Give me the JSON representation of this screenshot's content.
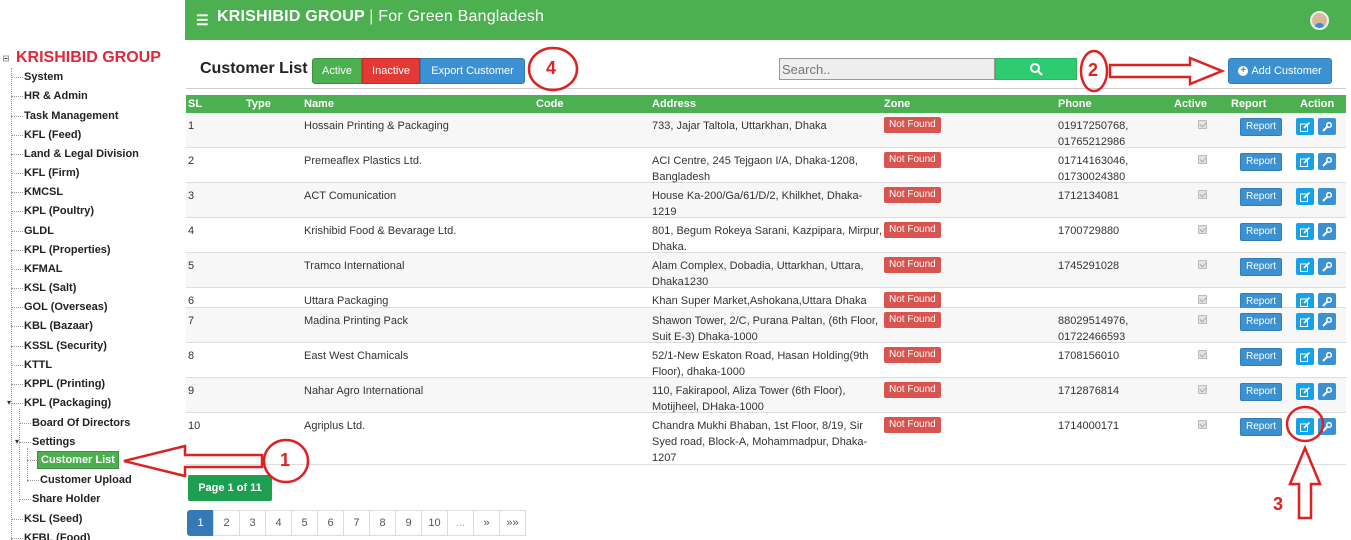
{
  "header": {
    "brand": "KRISHIBID GROUP",
    "separator": "|",
    "tagline": "For Green Bangladesh"
  },
  "sidebar": {
    "root": "KRISHIBID GROUP",
    "items": [
      {
        "label": "System"
      },
      {
        "label": "HR & Admin"
      },
      {
        "label": "Task Management"
      },
      {
        "label": "KFL (Feed)"
      },
      {
        "label": "Land & Legal Division"
      },
      {
        "label": "KFL (Firm)"
      },
      {
        "label": "KMCSL"
      },
      {
        "label": "KPL (Poultry)"
      },
      {
        "label": "GLDL"
      },
      {
        "label": "KPL (Properties)"
      },
      {
        "label": "KFMAL"
      },
      {
        "label": "KSL (Salt)"
      },
      {
        "label": "GOL (Overseas)"
      },
      {
        "label": "KBL (Bazaar)"
      },
      {
        "label": "KSSL (Security)"
      },
      {
        "label": "KTTL"
      },
      {
        "label": "KPPL (Printing)"
      },
      {
        "label": "KPL (Packaging)"
      },
      {
        "label": "Board Of Directors"
      },
      {
        "label": "Settings"
      },
      {
        "label": "Customer List"
      },
      {
        "label": "Customer Upload"
      },
      {
        "label": "Share Holder"
      },
      {
        "label": "KSL (Seed)"
      },
      {
        "label": "KFBL (Food)"
      }
    ]
  },
  "toolbar": {
    "title": "Customer List",
    "active_label": "Active",
    "inactive_label": "Inactive",
    "export_label": "Export Customer",
    "search_placeholder": "Search..",
    "add_label": "Add Customer"
  },
  "table": {
    "headers": {
      "sl": "SL",
      "type": "Type",
      "name": "Name",
      "code": "Code",
      "address": "Address",
      "zone": "Zone",
      "phone": "Phone",
      "active": "Active",
      "report": "Report",
      "action": "Action"
    },
    "rows": [
      {
        "sl": "1",
        "name": "Hossain Printing & Packaging",
        "address": "733, Jajar Taltola, Uttarkhan, Dhaka",
        "zone": "Not Found",
        "phone": "01917250768, 01765212986",
        "report": "Report"
      },
      {
        "sl": "2",
        "name": "Premeaflex Plastics Ltd.",
        "address": "ACI Centre, 245 Tejgaon I/A, Dhaka-1208, Bangladesh",
        "zone": "Not Found",
        "phone": "01714163046, 01730024380",
        "report": "Report"
      },
      {
        "sl": "3",
        "name": "ACT Comunication",
        "address": "House Ka-200/Ga/61/D/2, Khilkhet, Dhaka-1219",
        "zone": "Not Found",
        "phone": "1712134081",
        "report": "Report"
      },
      {
        "sl": "4",
        "name": "Krishibid Food & Bevarage Ltd.",
        "address": "801, Begum Rokeya Sarani, Kazpipara, Mirpur, Dhaka.",
        "zone": "Not Found",
        "phone": "1700729880",
        "report": "Report"
      },
      {
        "sl": "5",
        "name": "Tramco International",
        "address": "Alam Complex, Dobadia, Uttarkhan, Uttara, Dhaka1230",
        "zone": "Not Found",
        "phone": "1745291028",
        "report": "Report"
      },
      {
        "sl": "6",
        "name": "Uttara Packaging",
        "address": "Khan Super Market,Ashokana,Uttara Dhaka",
        "zone": "Not Found",
        "phone": "",
        "report": "Report"
      },
      {
        "sl": "7",
        "name": "Madina Printing Pack",
        "address": "Shawon Tower, 2/C, Purana Paltan, (6th Floor, Suit E-3) Dhaka-1000",
        "zone": "Not Found",
        "phone": "88029514976, 01722466593",
        "report": "Report"
      },
      {
        "sl": "8",
        "name": "East West Chamicals",
        "address": "52/1-New Eskaton Road, Hasan Holding(9th Floor), dhaka-1000",
        "zone": "Not Found",
        "phone": "1708156010",
        "report": "Report"
      },
      {
        "sl": "9",
        "name": "Nahar Agro International",
        "address": "110, Fakirapool, Aliza Tower (6th Floor), Motijheel, DHaka-1000",
        "zone": "Not Found",
        "phone": "1712876814",
        "report": "Report"
      },
      {
        "sl": "10",
        "name": "Agriplus Ltd.",
        "address": "Chandra Mukhi Bhaban, 1st Floor, 8/19, Sir Syed road, Block-A, Mohammadpur, Dhaka-1207",
        "zone": "Not Found",
        "phone": "1714000171",
        "report": "Report"
      }
    ]
  },
  "page_info": "Page 1 of 11",
  "pagination": [
    "1",
    "2",
    "3",
    "4",
    "5",
    "6",
    "7",
    "8",
    "9",
    "10",
    "...",
    "»",
    "»»"
  ],
  "annotations": [
    "1",
    "2",
    "3",
    "4"
  ],
  "colors": {
    "brand_green": "#4caf50",
    "danger": "#e53935",
    "primary": "#3b91d1",
    "annotation_red": "#dd2222"
  }
}
